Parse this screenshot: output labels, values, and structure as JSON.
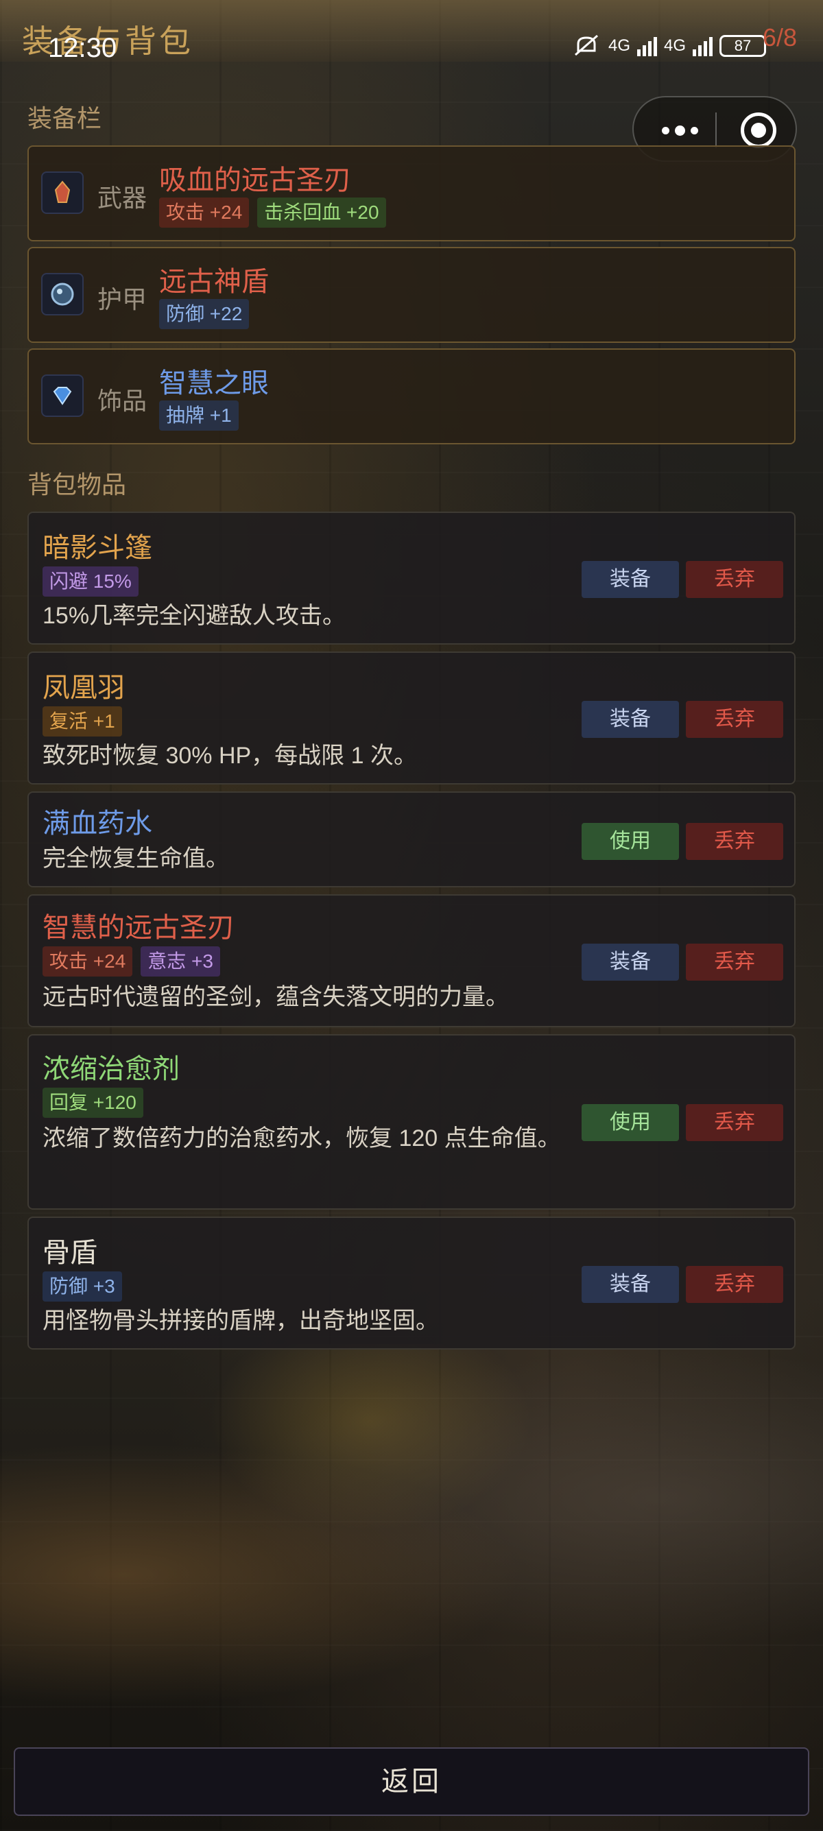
{
  "page": {
    "title": "装备与背包",
    "counter": "6/8"
  },
  "statusbar": {
    "time": "12:30",
    "net1": "4G",
    "net2": "4G",
    "battery": "87"
  },
  "sections": {
    "equipment": "装备栏",
    "bag": "背包物品"
  },
  "equipment": [
    {
      "slot": "武器",
      "name": "吸血的远古圣刃",
      "icon": "weapon-icon",
      "name_color": "#e0604a",
      "tags": [
        {
          "label": "攻击 +24",
          "style": "red"
        },
        {
          "label": "击杀回血 +20",
          "style": "green"
        }
      ]
    },
    {
      "slot": "护甲",
      "name": "远古神盾",
      "icon": "shield-icon",
      "name_color": "#e0604a",
      "tags": [
        {
          "label": "防御 +22",
          "style": "blue"
        }
      ]
    },
    {
      "slot": "饰品",
      "name": "智慧之眼",
      "icon": "gem-icon",
      "name_color": "#6e9be8",
      "tags": [
        {
          "label": "抽牌 +1",
          "style": "blue"
        }
      ]
    }
  ],
  "bag": [
    {
      "name": "暗影斗篷",
      "name_color": "#e3a44d",
      "tags": [
        {
          "label": "闪避 15%",
          "style": "purple"
        }
      ],
      "desc": "15%几率完全闪避敌人攻击。",
      "action": "装备",
      "drop": "丢弃"
    },
    {
      "name": "凤凰羽",
      "name_color": "#e3a44d",
      "tags": [
        {
          "label": "复活 +1",
          "style": "orange"
        }
      ],
      "desc": "致死时恢复 30% HP，每战限 1 次。",
      "action": "装备",
      "drop": "丢弃"
    },
    {
      "name": "满血药水",
      "name_color": "#6e9be8",
      "tags": [],
      "desc": "完全恢复生命值。",
      "action": "使用",
      "drop": "丢弃"
    },
    {
      "name": "智慧的远古圣刃",
      "name_color": "#e0604a",
      "tags": [
        {
          "label": "攻击 +24",
          "style": "red"
        },
        {
          "label": "意志 +3",
          "style": "purple"
        }
      ],
      "desc": "远古时代遗留的圣剑，蕴含失落文明的力量。",
      "action": "装备",
      "drop": "丢弃"
    },
    {
      "name": "浓缩治愈剂",
      "name_color": "#8fd877",
      "tags": [
        {
          "label": "回复 +120",
          "style": "green"
        }
      ],
      "desc": "浓缩了数倍药力的治愈药水，恢复 120 点生命值。",
      "action": "使用",
      "drop": "丢弃"
    },
    {
      "name": "骨盾",
      "name_color": "#e8e2d4",
      "tags": [
        {
          "label": "防御 +3",
          "style": "blue"
        }
      ],
      "desc": "用怪物骨头拼接的盾牌，出奇地坚固。",
      "action": "装备",
      "drop": "丢弃"
    }
  ],
  "footer": {
    "back_label": "返回"
  }
}
